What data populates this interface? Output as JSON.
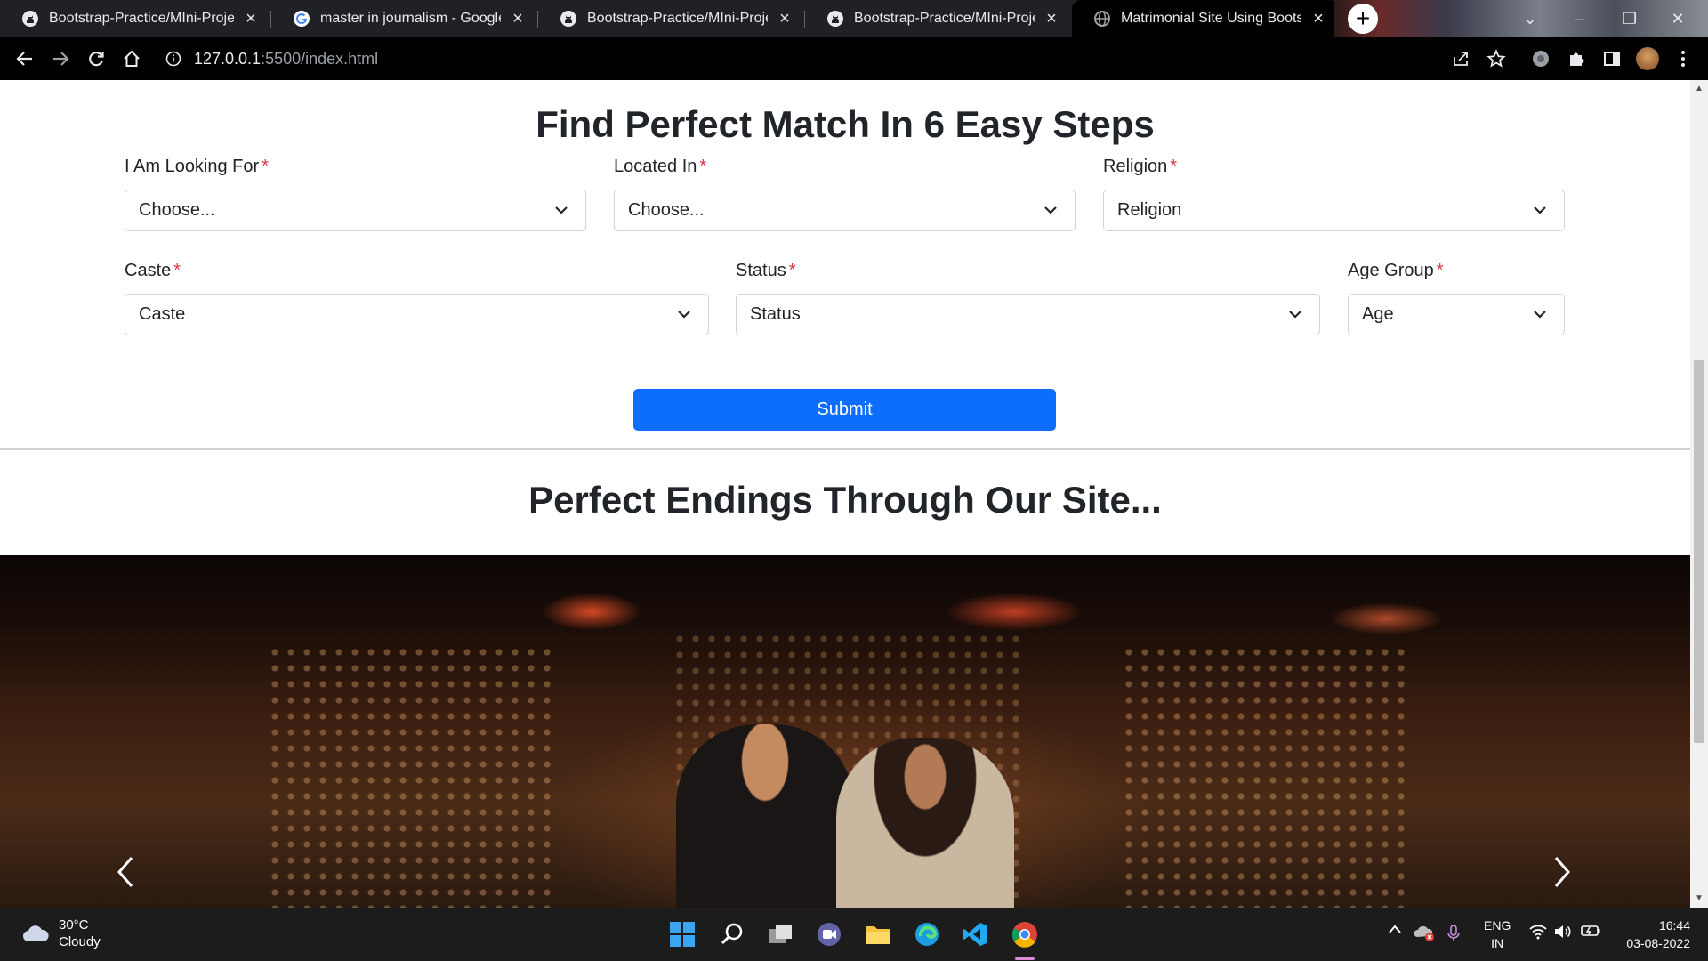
{
  "browser": {
    "tabs": [
      {
        "title": "Bootstrap-Practice/MIni-Project_",
        "icon": "github-icon",
        "active": false
      },
      {
        "title": "master in journalism - Google Se",
        "icon": "google-icon",
        "active": false
      },
      {
        "title": "Bootstrap-Practice/MIni-Project_",
        "icon": "github-icon",
        "active": false
      },
      {
        "title": "Bootstrap-Practice/MIni-Project_",
        "icon": "github-icon",
        "active": false
      },
      {
        "title": "Matrimonial Site Using Bootstrap",
        "icon": "globe-icon",
        "active": true
      }
    ],
    "new_tab": "+",
    "url_host": "127.0.0.1",
    "url_path": ":5500/index.html",
    "close_glyph": "×"
  },
  "form": {
    "title": "Find Perfect Match In 6 Easy Steps",
    "required_mark": "*",
    "fields": [
      {
        "label": "I Am Looking For",
        "value": "Choose..."
      },
      {
        "label": "Located In",
        "value": "Choose..."
      },
      {
        "label": "Religion",
        "value": "Religion"
      },
      {
        "label": "Caste",
        "value": "Caste"
      },
      {
        "label": "Status",
        "value": "Status"
      },
      {
        "label": "Age Group",
        "value": "Age"
      }
    ],
    "submit_label": "Submit"
  },
  "gallery": {
    "title": "Perfect Endings Through Our Site..."
  },
  "taskbar": {
    "weather_temp": "30°C",
    "weather_desc": "Cloudy",
    "lang_line1": "ENG",
    "lang_line2": "IN",
    "time": "16:44",
    "date": "03-08-2022"
  },
  "colors": {
    "primary": "#0d6efd",
    "required": "#dc3545",
    "text": "#212529"
  }
}
